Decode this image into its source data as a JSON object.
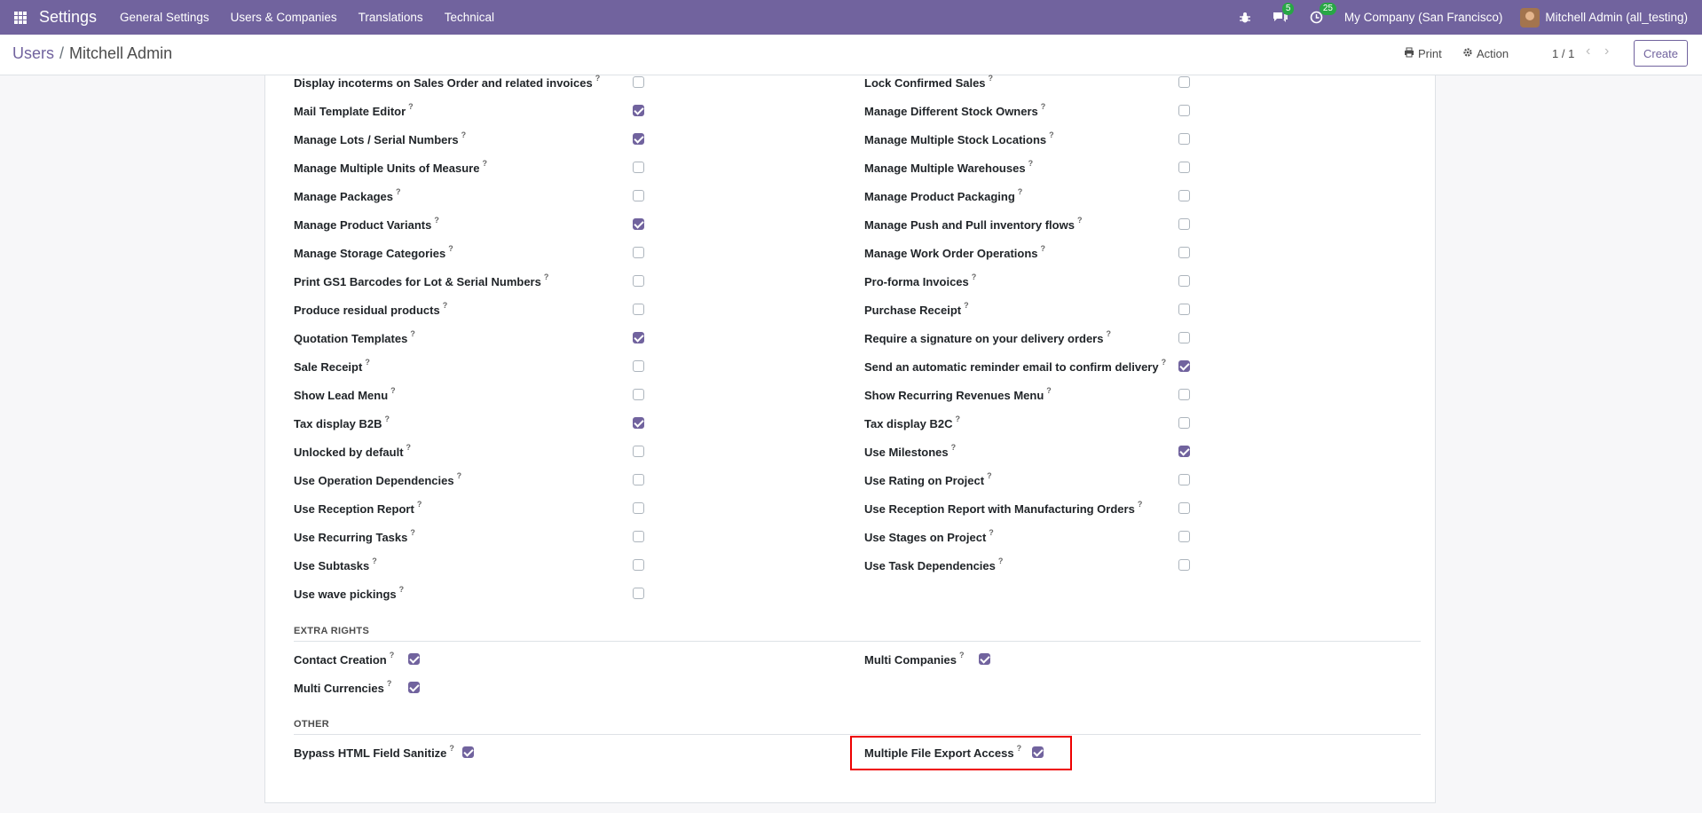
{
  "navbar": {
    "app_title": "Settings",
    "menu": [
      "General Settings",
      "Users & Companies",
      "Translations",
      "Technical"
    ],
    "messages_count": "5",
    "activities_count": "25",
    "company": "My Company (San Francisco)",
    "user": "Mitchell Admin (all_testing)",
    "bg_color": "#71639e"
  },
  "control_panel": {
    "breadcrumb_parent": "Users",
    "breadcrumb_separator": "/",
    "breadcrumb_current": "Mitchell Admin",
    "print_label": "Print",
    "action_label": "Action",
    "pager": "1 / 1",
    "create_label": "Create"
  },
  "left_column": [
    {
      "label": "Display incoterms on Sales Order and related invoices",
      "checked": false
    },
    {
      "label": "Mail Template Editor",
      "checked": true
    },
    {
      "label": "Manage Lots / Serial Numbers",
      "checked": true
    },
    {
      "label": "Manage Multiple Units of Measure",
      "checked": false
    },
    {
      "label": "Manage Packages",
      "checked": false
    },
    {
      "label": "Manage Product Variants",
      "checked": true
    },
    {
      "label": "Manage Storage Categories",
      "checked": false
    },
    {
      "label": "Print GS1 Barcodes for Lot & Serial Numbers",
      "checked": false
    },
    {
      "label": "Produce residual products",
      "checked": false
    },
    {
      "label": "Quotation Templates",
      "checked": true
    },
    {
      "label": "Sale Receipt",
      "checked": false
    },
    {
      "label": "Show Lead Menu",
      "checked": false
    },
    {
      "label": "Tax display B2B",
      "checked": true
    },
    {
      "label": "Unlocked by default",
      "checked": false
    },
    {
      "label": "Use Operation Dependencies",
      "checked": false
    },
    {
      "label": "Use Reception Report",
      "checked": false
    },
    {
      "label": "Use Recurring Tasks",
      "checked": false
    },
    {
      "label": "Use Subtasks",
      "checked": false
    },
    {
      "label": "Use wave pickings",
      "checked": false
    }
  ],
  "right_column": [
    {
      "label": "Lock Confirmed Sales",
      "checked": false
    },
    {
      "label": "Manage Different Stock Owners",
      "checked": false
    },
    {
      "label": "Manage Multiple Stock Locations",
      "checked": false
    },
    {
      "label": "Manage Multiple Warehouses",
      "checked": false
    },
    {
      "label": "Manage Product Packaging",
      "checked": false
    },
    {
      "label": "Manage Push and Pull inventory flows",
      "checked": false
    },
    {
      "label": "Manage Work Order Operations",
      "checked": false
    },
    {
      "label": "Pro-forma Invoices",
      "checked": false
    },
    {
      "label": "Purchase Receipt",
      "checked": false
    },
    {
      "label": "Require a signature on your delivery orders",
      "checked": false
    },
    {
      "label": "Send an automatic reminder email to confirm delivery",
      "checked": true
    },
    {
      "label": "Show Recurring Revenues Menu",
      "checked": false
    },
    {
      "label": "Tax display B2C",
      "checked": false
    },
    {
      "label": "Use Milestones",
      "checked": true
    },
    {
      "label": "Use Rating on Project",
      "checked": false
    },
    {
      "label": "Use Reception Report with Manufacturing Orders",
      "checked": false
    },
    {
      "label": "Use Stages on Project",
      "checked": false
    },
    {
      "label": "Use Task Dependencies",
      "checked": false
    }
  ],
  "help_marker": "?",
  "extra_rights": {
    "title": "EXTRA RIGHTS",
    "items": [
      {
        "label": "Contact Creation",
        "checked": true
      },
      {
        "label": "Multi Companies",
        "checked": true
      },
      {
        "label": "Multi Currencies",
        "checked": true
      }
    ]
  },
  "other": {
    "title": "OTHER",
    "items": [
      {
        "label": "Bypass HTML Field Sanitize",
        "checked": true
      },
      {
        "label": "Multiple File Export Access",
        "checked": true
      }
    ]
  }
}
